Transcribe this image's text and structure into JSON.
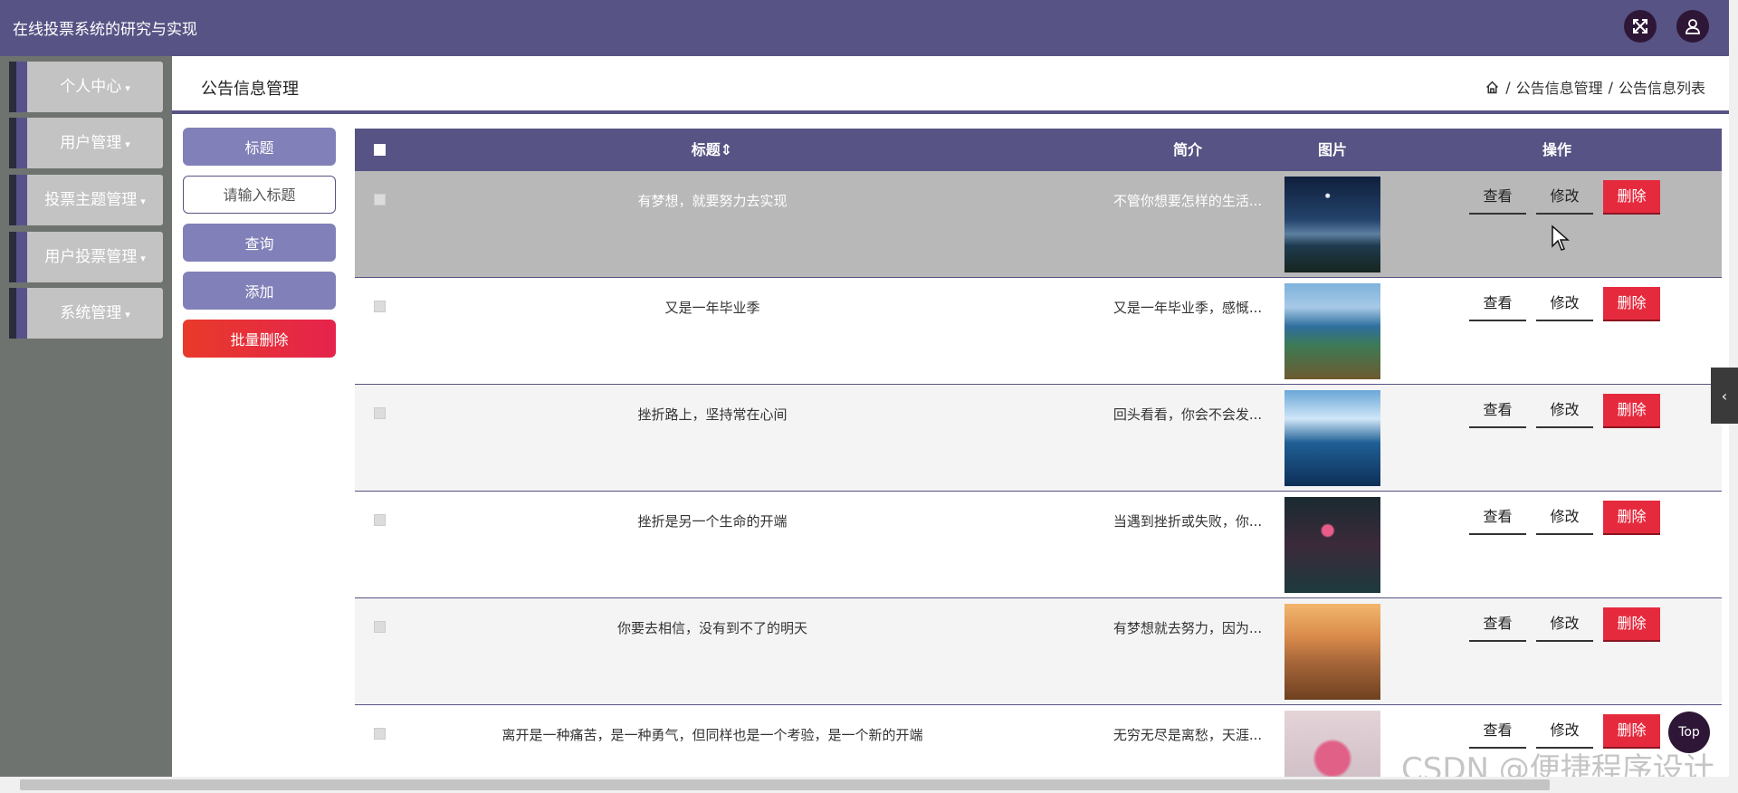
{
  "header": {
    "app_title": "在线投票系统的研究与实现",
    "fullscreen_icon": "expand-arrows-icon",
    "user_icon": "user-icon"
  },
  "sidebar": {
    "items": [
      {
        "label": "个人中心"
      },
      {
        "label": "用户管理"
      },
      {
        "label": "投票主题管理"
      },
      {
        "label": "用户投票管理"
      },
      {
        "label": "系统管理"
      }
    ]
  },
  "page": {
    "title": "公告信息管理",
    "breadcrumb": {
      "sep1": "/",
      "level1": "公告信息管理",
      "sep2": "/",
      "level2": "公告信息列表"
    }
  },
  "controls": {
    "filter_label": "标题",
    "search_placeholder": "请输入标题",
    "query_button": "查询",
    "add_button": "添加",
    "batch_delete_button": "批量删除"
  },
  "table": {
    "headers": {
      "title": "标题",
      "sort_icon": "⇕",
      "summary": "简介",
      "image": "图片",
      "actions": "操作"
    },
    "action_labels": {
      "view": "查看",
      "edit": "修改",
      "delete": "删除"
    },
    "rows": [
      {
        "title": "有梦想，就要努力去实现",
        "summary": "不管你想要怎样的生活...",
        "image": "starry-lake-photo"
      },
      {
        "title": "又是一年毕业季",
        "summary": "又是一年毕业季，感慨...",
        "image": "blue-lake-island-photo"
      },
      {
        "title": "挫折路上，坚持常在心间",
        "summary": "回头看看，你会不会发...",
        "image": "aurora-lake-photo"
      },
      {
        "title": "挫折是另一个生命的开端",
        "summary": "当遇到挫折或失败，你...",
        "image": "moon-flowers-photo"
      },
      {
        "title": "你要去相信，没有到不了的明天",
        "summary": "有梦想就去努力，因为...",
        "image": "sunset-castle-photo"
      },
      {
        "title": "离开是一种痛苦，是一种勇气，但同样也是一个考验，是一个新的开端",
        "summary": "无穷无尽是离愁，天涯...",
        "image": "pink-flower-photo"
      }
    ]
  },
  "overlay": {
    "top_button": "Top",
    "watermark": "CSDN @便捷程序设计"
  },
  "colors": {
    "primary": "#575384",
    "sidebar_bg": "#6f736f",
    "danger": "#e62a3e",
    "selected_row": "#b8b8b8"
  }
}
